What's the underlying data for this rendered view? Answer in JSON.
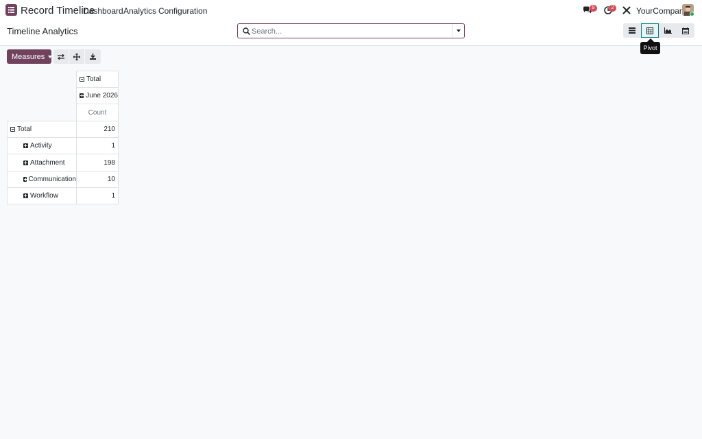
{
  "navbar": {
    "app_name": "Record Timeline",
    "menu": [
      "Dashboard",
      "Analytics",
      "Configuration"
    ],
    "messages_count": "9",
    "activities_count": "2",
    "company": "YourCompany"
  },
  "control_panel": {
    "page_title": "Timeline Analytics",
    "search_placeholder": "Search...",
    "views": [
      "list-view-icon",
      "pivot-view-icon",
      "graph-view-icon",
      "calendar-view-icon"
    ],
    "active_view": "pivot-view-icon",
    "tooltip": "Pivot"
  },
  "toolbar": {
    "measures_label": "Measures"
  },
  "pivot": {
    "col_header_total": "Total",
    "col_header_group": "June 2026",
    "measure": "Count",
    "row_total_label": "Total",
    "row_total_value": "210",
    "rows": [
      {
        "label": "Activity",
        "value": "1"
      },
      {
        "label": "Attachment",
        "value": "198"
      },
      {
        "label": "Communication",
        "value": "10"
      },
      {
        "label": "Workflow",
        "value": "1"
      }
    ]
  },
  "colors": {
    "brand": "#71425e",
    "active_view_border": "#017e84",
    "badge": "#d44c59"
  }
}
